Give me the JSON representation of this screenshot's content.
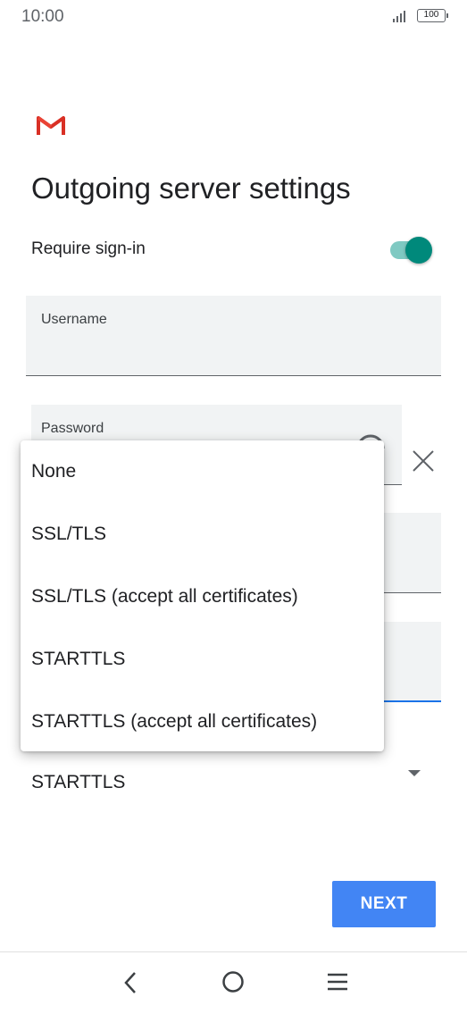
{
  "status_bar": {
    "time": "10:00",
    "battery": "100"
  },
  "header": {
    "logo_icon": "gmail-m-icon",
    "title": "Outgoing server settings"
  },
  "require_signin": {
    "label": "Require sign-in",
    "enabled": true,
    "accent": "#00897b"
  },
  "fields": {
    "username_label": "Username",
    "password_label": "Password"
  },
  "security": {
    "selected": "STARTTLS",
    "options": [
      "None",
      "SSL/TLS",
      "SSL/TLS (accept all certificates)",
      "STARTTLS",
      "STARTTLS (accept all certificates)"
    ]
  },
  "actions": {
    "next_label": "NEXT",
    "next_color": "#4285f4"
  },
  "nav": {
    "back_icon": "back-icon",
    "home_icon": "home-icon",
    "menu_icon": "menu-icon"
  }
}
